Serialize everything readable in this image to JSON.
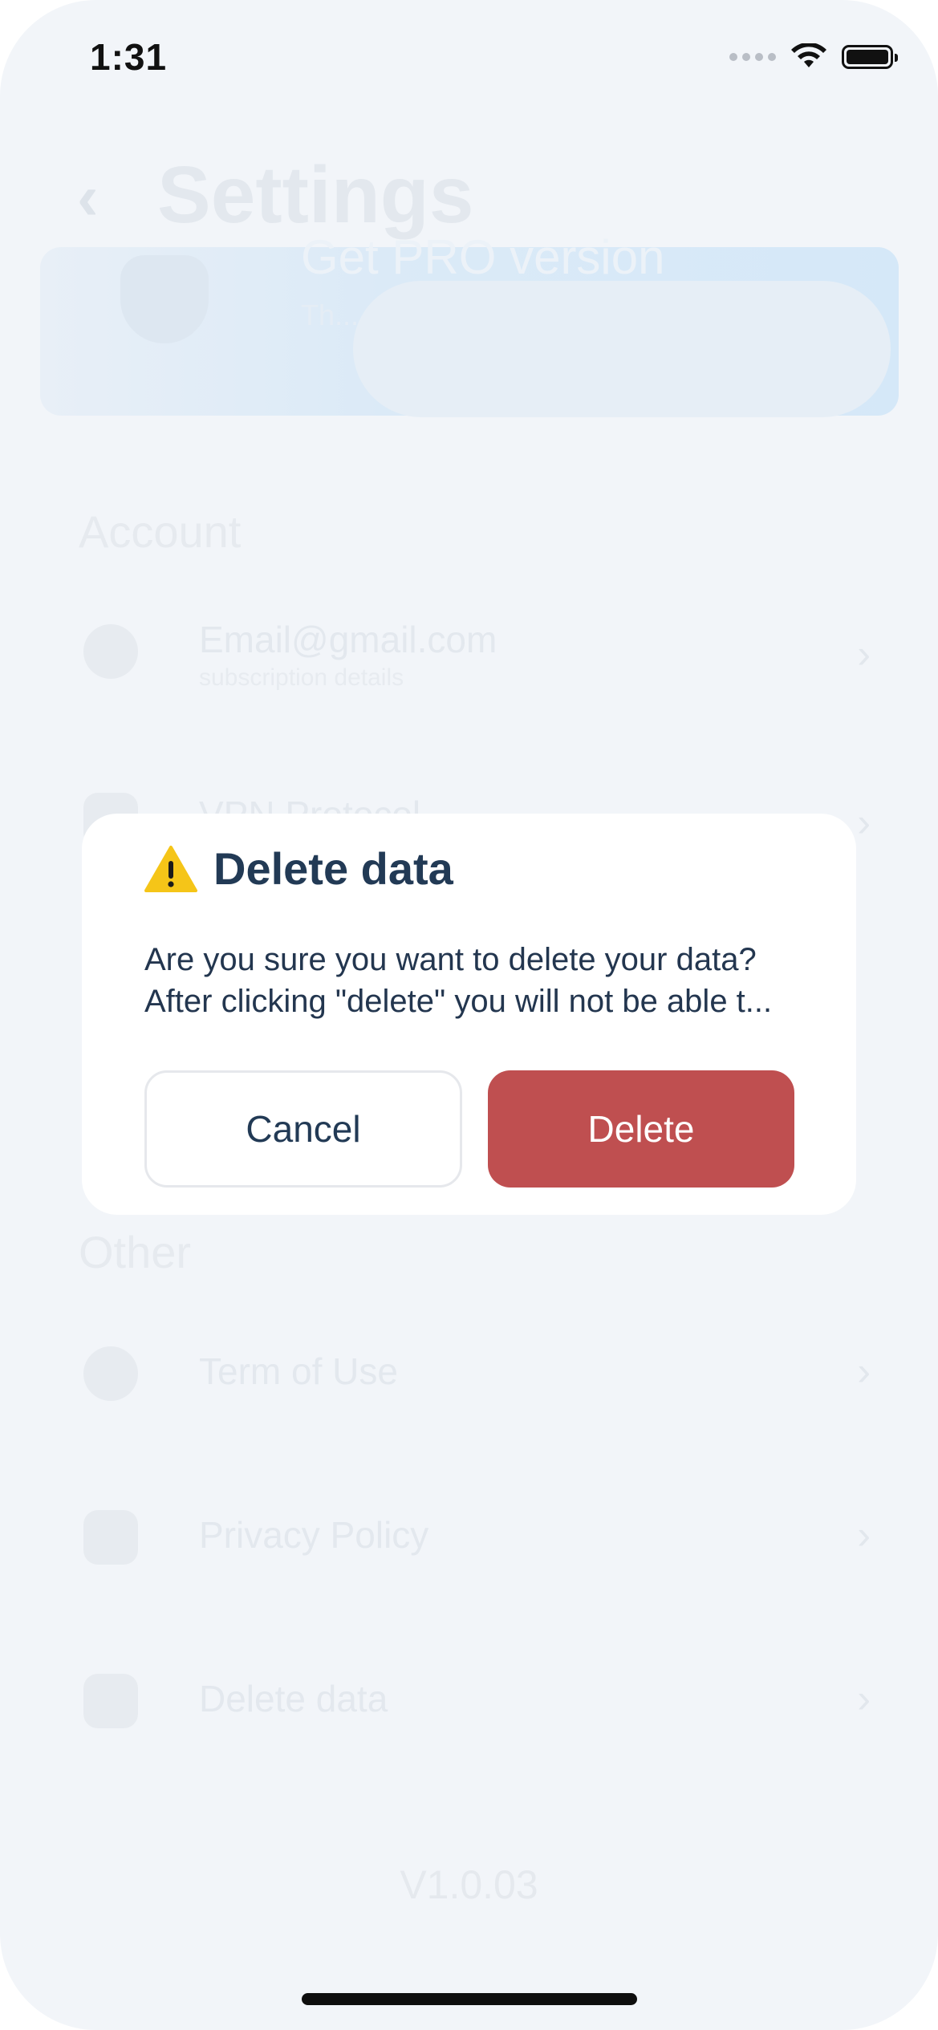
{
  "status_bar": {
    "time": "1:31"
  },
  "background": {
    "title": "Settings",
    "pro_card": {
      "title": "Get PRO version",
      "subtitle": "Th..."
    },
    "sections": [
      {
        "title": "Account",
        "items": [
          {
            "label": "Email@gmail.com",
            "sublabel": "subscription details"
          },
          {
            "label": "VPN Protocol"
          }
        ]
      },
      {
        "title": "Other",
        "items": [
          {
            "label": "Term of Use"
          },
          {
            "label": "Privacy Policy"
          },
          {
            "label": "Delete data"
          }
        ]
      }
    ],
    "version": "V1.0.03"
  },
  "dialog": {
    "icon": "warning-icon",
    "title": "Delete data",
    "message_line1": "Are you sure you want to delete your data?",
    "message_line2": "After clicking \"delete\" you will not be able t...",
    "cancel_label": "Cancel",
    "delete_label": "Delete"
  },
  "colors": {
    "delete_button": "#bf4f50",
    "title_text": "#223a55",
    "warning": "#f5c518"
  }
}
